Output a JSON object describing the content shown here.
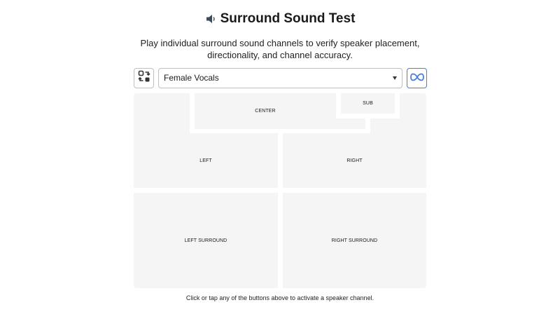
{
  "header": {
    "title": "Surround Sound Test",
    "subtitle": "Play individual surround sound channels to verify speaker placement, directionality, and channel accuracy."
  },
  "toolbar": {
    "swap_icon": "swap-arrows-icon",
    "selected_track": "Female Vocals",
    "loop_icon": "infinity-icon",
    "accent_color": "#4a7fd8"
  },
  "speakers": {
    "center": "CENTER",
    "sub": "SUB",
    "left": "LEFT",
    "right": "RIGHT",
    "left_surround": "LEFT SURROUND",
    "right_surround": "RIGHT SURROUND"
  },
  "footer": {
    "hint": "Click or tap any of the buttons above to activate a speaker channel."
  }
}
